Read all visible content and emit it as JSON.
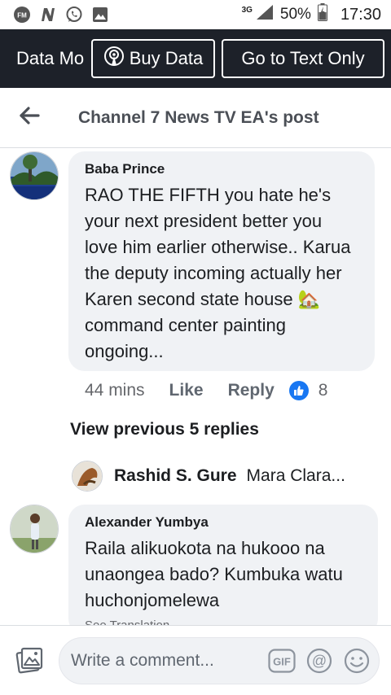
{
  "status_bar": {
    "network": "3G",
    "battery": "50%",
    "time": "17:30"
  },
  "data_bar": {
    "mode_label": "Data Mo",
    "buy_data_label": "Buy Data",
    "text_only_label": "Go to Text Only"
  },
  "post_header": {
    "title": "Channel 7 News TV EA's post"
  },
  "comments": [
    {
      "author": "Baba Prince",
      "text": "RAO THE FIFTH you hate he's your next president better you love him earlier otherwise.. Karua the deputy incoming actually her Karen second state house 🏡 command center painting ongoing...",
      "time": "44 mins",
      "like_label": "Like",
      "reply_label": "Reply",
      "reaction_count": "8"
    },
    {
      "author": "Alexander Yumbya",
      "text": "Raila  alikuokota na hukooo na unaongea bado? Kumbuka watu huchonjomelewa",
      "see_translation": "See Translation"
    }
  ],
  "view_previous": "View previous 5 replies",
  "reply_preview": {
    "author": "Rashid S. Gure",
    "text": "Mara Clara..."
  },
  "composer": {
    "placeholder": "Write a comment...",
    "gif_label": "GIF"
  },
  "colors": {
    "dark_bar": "#1d2129",
    "bubble": "#f0f2f5",
    "like_blue": "#1877f2",
    "muted_text": "#65676b"
  }
}
